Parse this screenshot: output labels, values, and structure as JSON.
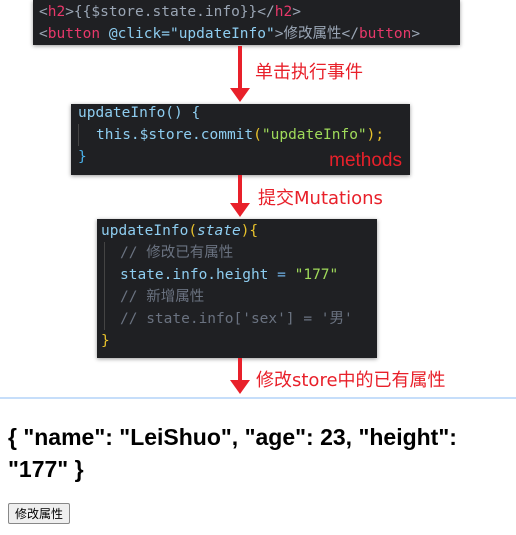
{
  "template_code": {
    "line1": [
      "<",
      "h2",
      ">{{$store.state.info}}</",
      "h2",
      ">"
    ],
    "line2": [
      "<",
      "button",
      " @click=",
      "\"updateInfo\"",
      ">修改属性</",
      "button",
      ">"
    ]
  },
  "methods_code": {
    "line1": "updateInfo() {",
    "line2_a": "this.$store.",
    "line2_b": "commit",
    "line2_c": "(",
    "line2_d": "\"updateInfo\"",
    "line2_e": ");",
    "line3": "}",
    "label": "methods"
  },
  "mutation_code": {
    "name": "updateInfo",
    "param": "state",
    "comment1": "// 修改已有属性",
    "assign_lhs": "state.info.height",
    "assign_op": " = ",
    "assign_rhs": "\"177\"",
    "comment2": "// 新增属性",
    "comment3": "// state.info['sex'] = '男'",
    "close": "}"
  },
  "arrows": {
    "step1": "单击执行事件",
    "step2": "提交Mutations",
    "step3": "修改store中的已有属性"
  },
  "page": {
    "heading": "{ \"name\": \"LeiShuo\", \"age\": 23, \"height\": \"177\" }",
    "button": "修改属性"
  },
  "colors": {
    "arrow": "#e8202a",
    "code_bg": "#1f2023"
  }
}
